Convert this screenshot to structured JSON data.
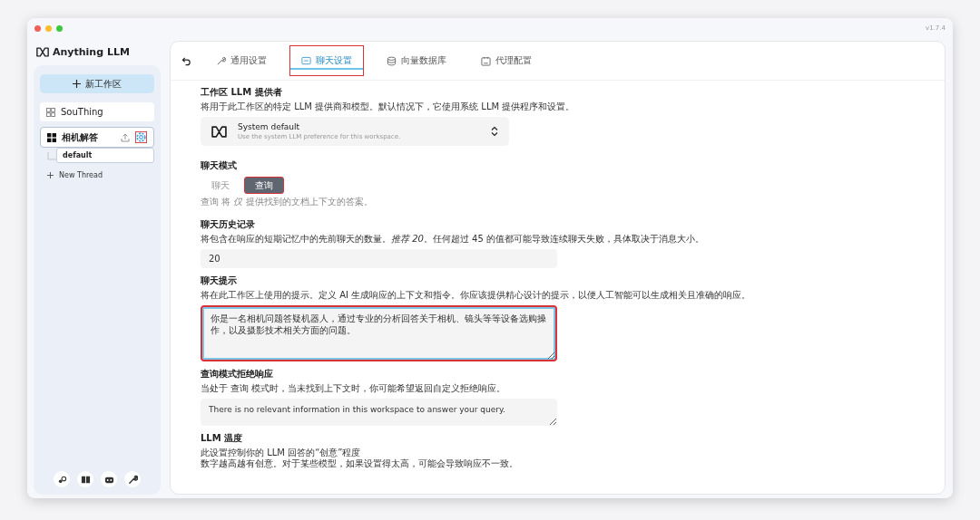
{
  "window": {
    "version": "v1.7.4"
  },
  "sidebar": {
    "logo": "Anything LLM",
    "new_workspace": "新工作区",
    "workspaces": [
      {
        "name": "SouThing",
        "selected": false,
        "settings_highlighted": false
      },
      {
        "name": "相机解答",
        "selected": true,
        "settings_highlighted": true,
        "threads": [
          {
            "name": "default",
            "selected": true
          }
        ],
        "new_thread": "New Thread"
      }
    ]
  },
  "tabs": [
    {
      "label": "通用设置",
      "selected": false,
      "highlighted": false
    },
    {
      "label": "聊天设置",
      "selected": true,
      "highlighted": true
    },
    {
      "label": "向量数据库",
      "selected": false,
      "highlighted": false
    },
    {
      "label": "代理配置",
      "selected": false,
      "highlighted": false
    }
  ],
  "provider": {
    "title": "工作区 LLM 提供者",
    "description": "将用于此工作区的特定 LLM 提供商和模型。默认情况下，它使用系统 LLM 提供程序和设置。",
    "name": "System default",
    "detail": "Use the system LLM preference for this workspace."
  },
  "chat_mode": {
    "title": "聊天模式",
    "options": [
      {
        "label": "聊天",
        "selected": false,
        "highlighted": false
      },
      {
        "label": "查询",
        "selected": true,
        "highlighted": true
      }
    ],
    "description": "查询 将 *仅* 提供找到的文档上下文的答案。"
  },
  "history": {
    "title": "聊天历史记录",
    "description": "将包含在响应的短期记忆中的先前聊天的数量。*推荐 20*。任何超过 45 的值都可能导致连续聊天失败，具体取决于消息大小。",
    "value": "20"
  },
  "prompt": {
    "title": "聊天提示",
    "description": "将在此工作区上使用的提示。定义 AI 生成响应的上下文和指令。你应该提供精心设计的提示，以便人工智能可以生成相关且准确的响应。",
    "value": "你是一名相机问题答疑机器人，通过专业的分析回答关于相机、镜头等等设备选购操作，以及摄影技术相关方面的问题。",
    "highlighted": true
  },
  "refusal": {
    "title": "查询模式拒绝响应",
    "description": "当处于 查询 模式时，当未找到上下文时，你可能希望返回自定义拒绝响应。",
    "value": "There is no relevant information in this workspace to answer your query."
  },
  "temperature": {
    "title": "LLM 温度",
    "description_lines": [
      "此设置控制你的 LLM 回答的“创意”程度",
      "数字越高越有创意。对于某些模型，如果设置得太高，可能会导致响应不一致。"
    ]
  }
}
